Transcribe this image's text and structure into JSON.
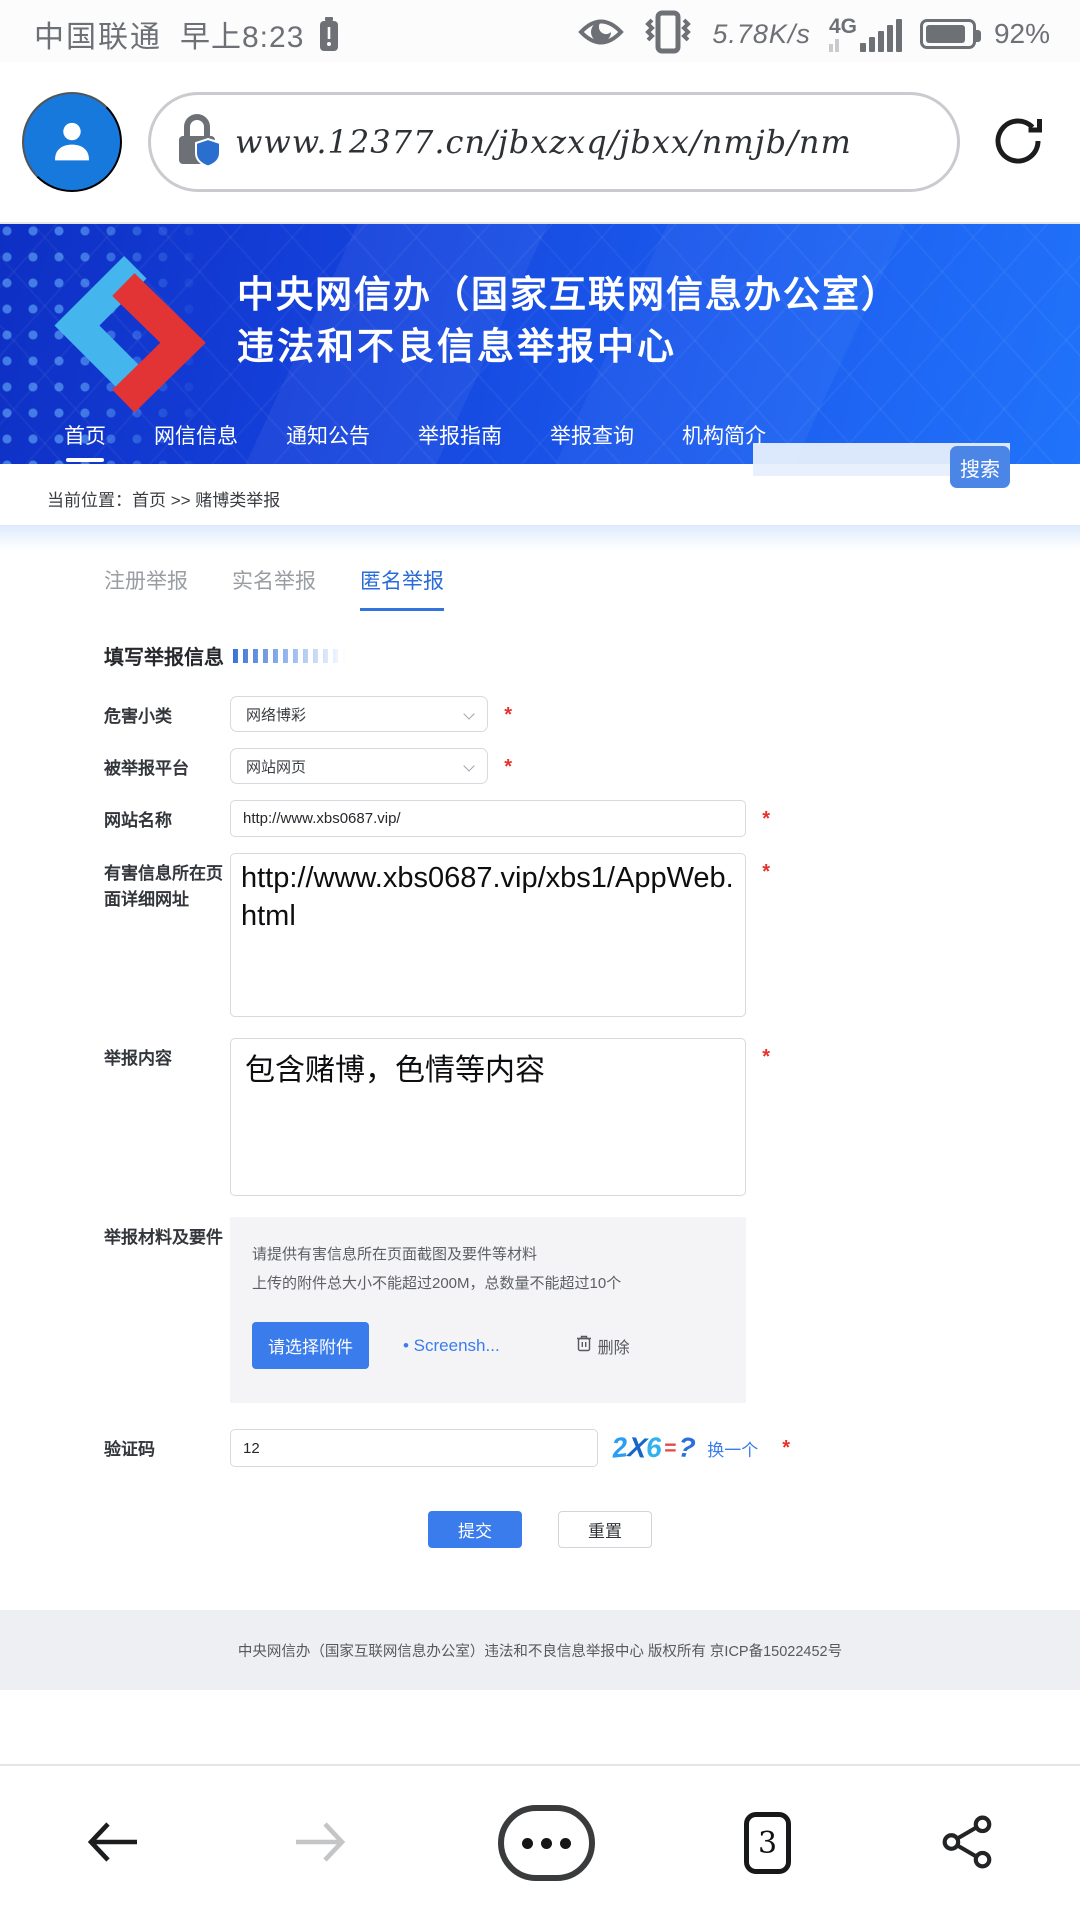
{
  "status_bar": {
    "carrier": "中国联通",
    "time": "早上8:23",
    "speed": "5.78K/s",
    "network": "4G",
    "battery_percent": "92%"
  },
  "browser": {
    "url": "www.12377.cn/jbxzxq/jbxx/nmjb/nm"
  },
  "site_header": {
    "title_line1": "中央网信办（国家互联网信息办公室）",
    "title_line2": "违法和不良信息举报中心",
    "nav": [
      "首页",
      "网信信息",
      "通知公告",
      "举报指南",
      "举报查询",
      "机构简介"
    ],
    "search_button": "搜索"
  },
  "breadcrumb": "当前位置：首页 >> 赌博类举报",
  "tabs": {
    "register": "注册举报",
    "realname": "实名举报",
    "anonymous": "匿名举报"
  },
  "form": {
    "section_title": "填写举报信息",
    "required_mark": "*",
    "harm_category": {
      "label": "危害小类",
      "value": "网络博彩"
    },
    "platform": {
      "label": "被举报平台",
      "value": "网站网页"
    },
    "site_name": {
      "label": "网站名称",
      "value": "http://www.xbs0687.vip/"
    },
    "detail_url": {
      "label": "有害信息所在页面详细网址",
      "value": "http://www.xbs0687.vip/xbs1/AppWeb.html"
    },
    "report_content": {
      "label": "举报内容",
      "value": "包含赌博，色情等内容"
    },
    "materials": {
      "label": "举报材料及要件",
      "hint1": "请提供有害信息所在页面截图及要件等材料",
      "hint2": "上传的附件总大小不能超过200M，总数量不能超过10个",
      "choose_button": "请选择附件",
      "file_link": "• Screensh...",
      "delete_label": "删除"
    },
    "captcha": {
      "label": "验证码",
      "value": "12",
      "chars": [
        "2",
        "X",
        "6",
        "=",
        "?"
      ],
      "refresh_link": "换一个"
    },
    "submit": "提交",
    "reset": "重置"
  },
  "footer": {
    "text": "中央网信办（国家互联网信息办公室）违法和不良信息举报中心 版权所有 京ICP备15022452号"
  },
  "bottom_nav": {
    "tab_count": "3"
  },
  "colors": {
    "accent_blue": "#3b7ced",
    "header_blue_start": "#0e2fc3",
    "header_blue_end": "#2173fa",
    "required_red": "#e8312a"
  }
}
